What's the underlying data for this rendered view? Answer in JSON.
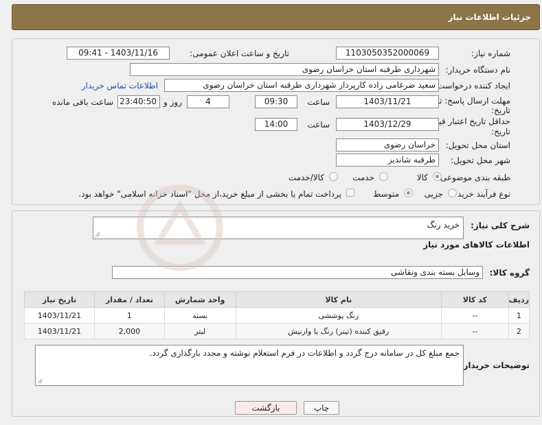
{
  "header": {
    "title": "جزئیات اطلاعات نیاز"
  },
  "form": {
    "need_number_label": "شماره نیاز:",
    "need_number": "1103050352000069",
    "announce_label": "تاریخ و ساعت اعلان عمومی:",
    "announce_value": "1403/11/16 - 09:41",
    "buyer_org_label": "نام دستگاه خریدار:",
    "buyer_org": "شهرداری طرقبه استان خراسان رضوی",
    "creator_label": "ایجاد کننده درخواست:",
    "creator": "سعید ضرغامی زاده کارپرداز  شهرداری طرقبه استان خراسان رضوی",
    "contact_link": "اطلاعات تماس خریدار",
    "reply_deadline_label": "مهلت ارسال پاسخ: تا",
    "reply_deadline_label2": "تاریخ:",
    "reply_date": "1403/11/21",
    "time_label": "ساعت",
    "reply_time": "09:30",
    "days_value": "4",
    "days_label": "روز و",
    "remaining_value": "23:40:50",
    "remaining_label": "ساعت باقی مانده",
    "price_valid_label": "حداقل تاریخ اعتبار قیمت: تا",
    "price_valid_label2": "تاریخ:",
    "price_valid_date": "1403/12/29",
    "price_valid_time": "14:00",
    "province_label": "استان محل تحویل:",
    "province": "خراسان رضوی",
    "city_label": "شهر محل تحویل:",
    "city": "طرقبه شاندیز",
    "category_label": "طبقه بندی موضوعی:",
    "category_options": [
      "کالا",
      "خدمت",
      "کالا/خدمت"
    ],
    "process_label": "نوع فرآیند خرید :",
    "process_options": [
      "جزیی",
      "متوسط"
    ],
    "payment_note": "پرداخت تمام یا بخشی از مبلغ خرید،از محل \"اسناد خزانه اسلامی\" خواهد بود."
  },
  "description": {
    "summary_label": "شرح کلی نیاز:",
    "summary_value": "خرید رنگ",
    "goods_info_title": "اطلاعات کالاهای مورد نیاز",
    "group_label": "گروه کالا:",
    "group_value": "وسایل بسته بندی  ونقاشی"
  },
  "table": {
    "headers": [
      "ردیف",
      "کد کالا",
      "نام کالا",
      "واحد شمارش",
      "تعداد / مقدار",
      "تاریخ نیاز"
    ],
    "rows": [
      [
        "1",
        "--",
        "رنگ پوششی",
        "بسته",
        "1",
        "1403/11/21"
      ],
      [
        "2",
        "--",
        "رقیق کننده (تینر) رنگ یا وارنیش",
        "لیتر",
        "2,000",
        "1403/11/21"
      ]
    ]
  },
  "notes": {
    "label": "توضیحات خریدار:",
    "value": "جمع مبلغ کل در سامانه درج گردد و اطلاعات در فرم استعلام نوشته و مجدد بارگذاری گردد."
  },
  "buttons": {
    "print": "چاپ",
    "back": "بازگشت"
  },
  "colors": {
    "header": "#8c7448",
    "link": "#1f4fb5",
    "back_button": "#fde9ea"
  }
}
